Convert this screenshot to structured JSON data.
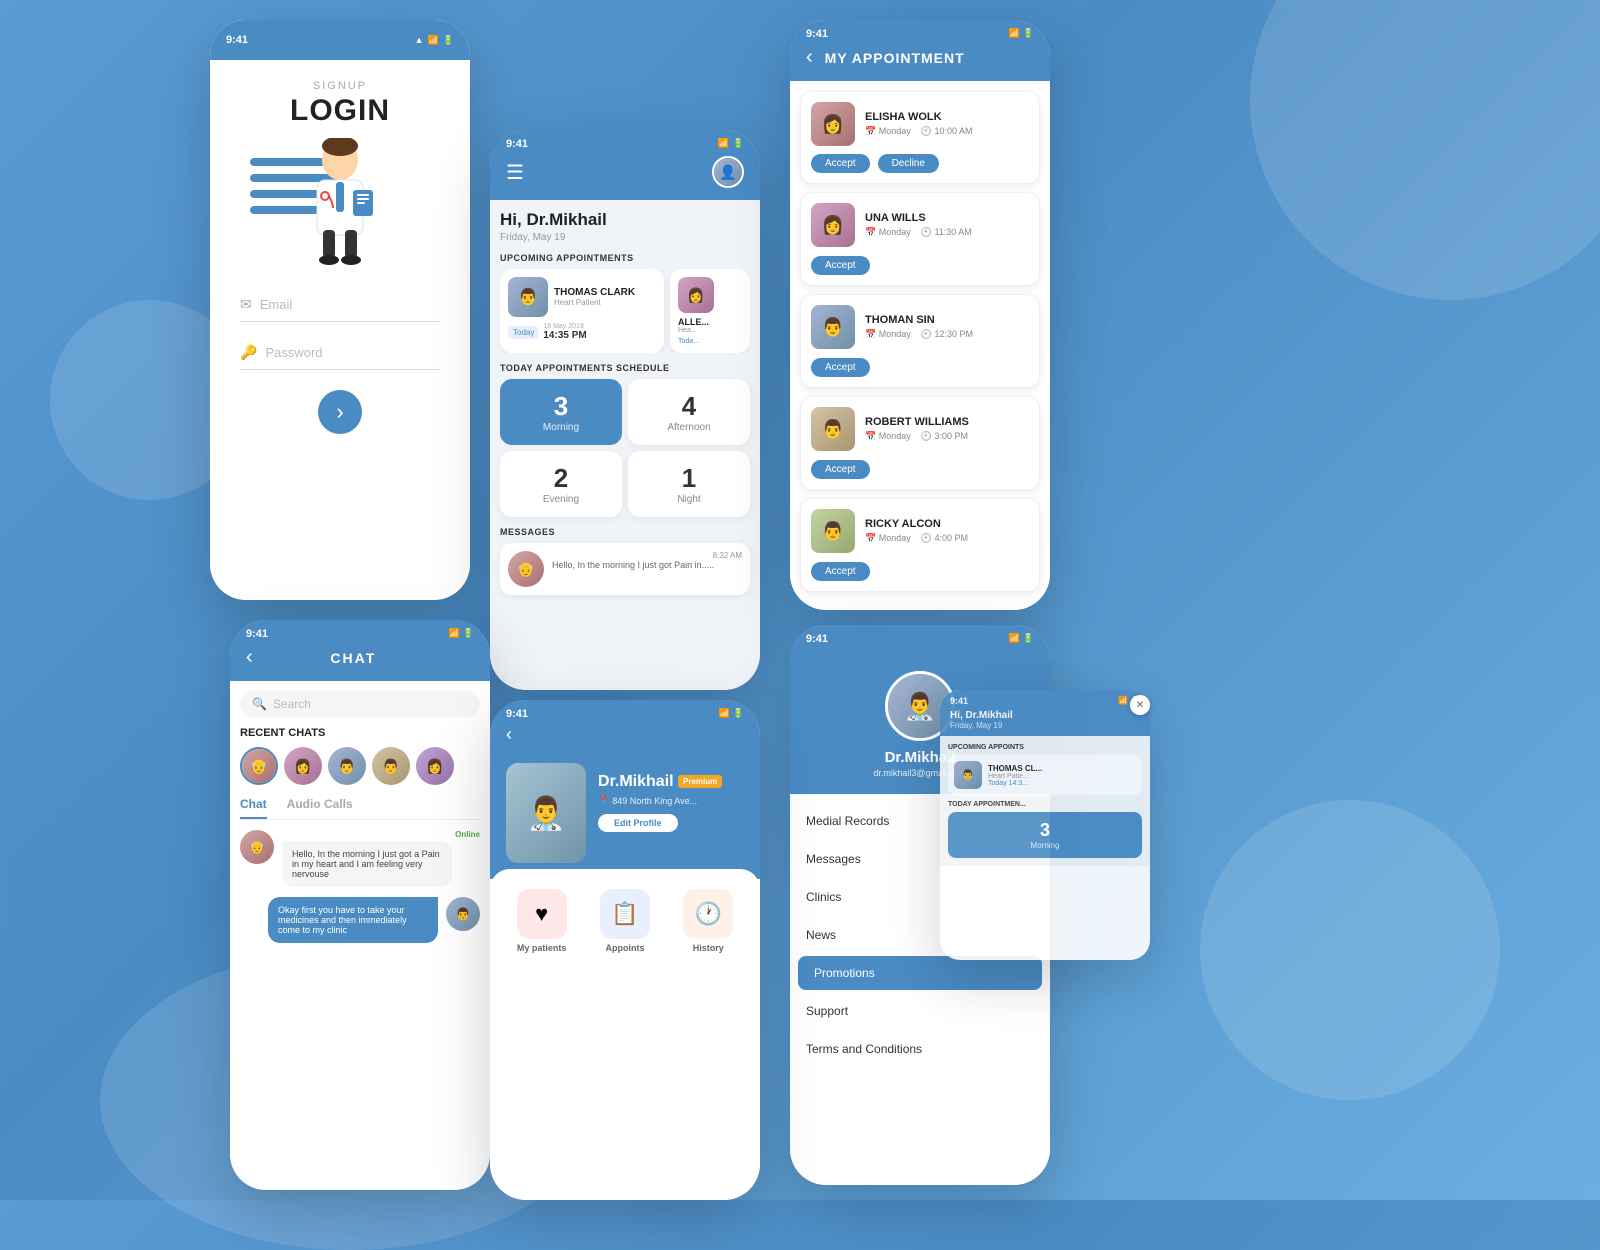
{
  "app": {
    "status_time": "9:41"
  },
  "login_screen": {
    "signup_label": "SIGNUP",
    "login_label": "LOGIN",
    "email_placeholder": "Email",
    "password_placeholder": "Password",
    "next_button": "›"
  },
  "dashboard": {
    "greeting": "Hi, Dr.Mikhail",
    "date": "Friday, May 19",
    "upcoming_title": "UPCOMING APPOINTMENTS",
    "appointments": [
      {
        "name": "THOMAS CLARK",
        "type": "Heart Patient",
        "day": "Today",
        "date": "18 May 2019",
        "time": "14:35 PM",
        "avatar_class": "fp2"
      },
      {
        "name": "ALLE...",
        "type": "Hea...",
        "day": "Toda...",
        "date": "",
        "time": "",
        "avatar_class": "fp7"
      }
    ],
    "schedule_title": "TODAY APPOINTMENTS SCHEDULE",
    "schedule": [
      {
        "count": "3",
        "label": "Morning",
        "highlighted": true
      },
      {
        "count": "4",
        "label": "Afternoon",
        "highlighted": false
      },
      {
        "count": "2",
        "label": "Evening",
        "highlighted": false
      },
      {
        "count": "1",
        "label": "Night",
        "highlighted": false
      }
    ],
    "messages_title": "MESSAGES",
    "message": {
      "text": "Hello, In the morning I just got Pain in.....",
      "time": "8:32 AM",
      "avatar_class": "fp1"
    }
  },
  "appointment_screen": {
    "title": "MY APPOINTMENT",
    "back_label": "‹",
    "patients": [
      {
        "name": "ELISHA WOLK",
        "day": "Monday",
        "time": "10:00 AM",
        "actions": [
          "Accept",
          "Decline"
        ],
        "avatar_class": "fp1"
      },
      {
        "name": "UNA WILLS",
        "day": "Monday",
        "time": "11:30 AM",
        "actions": [
          "Accept"
        ],
        "avatar_class": "fp7"
      },
      {
        "name": "THOMAN SIN",
        "day": "Monday",
        "time": "12:30 PM",
        "actions": [
          "Accept"
        ],
        "avatar_class": "fp2"
      },
      {
        "name": "ROBERT WILLIAMS",
        "day": "Monday",
        "time": "3:00 PM",
        "actions": [
          "Accept"
        ],
        "avatar_class": "fp4"
      },
      {
        "name": "RICKY ALCON",
        "day": "Monday",
        "time": "4:00 PM",
        "actions": [
          "Accept"
        ],
        "avatar_class": "fp8"
      }
    ]
  },
  "chat_screen": {
    "title": "CHAT",
    "back_label": "‹",
    "search_placeholder": "Search",
    "recent_chats_label": "RECENT CHATS",
    "tabs": [
      "Chat",
      "Audio Calls"
    ],
    "active_tab": "Chat",
    "avatars": [
      "fp1",
      "fp7",
      "fp2",
      "fp4",
      "fp5"
    ],
    "messages": [
      {
        "sender": "Patient",
        "text": "Hello, In the morning I just got a Pain in my heart and I am feeling very nervouse",
        "online": true,
        "avatar_class": "fp1"
      },
      {
        "sender": "Doctor",
        "text": "Okay first you have to take your medicines and then immediately come to my clinic",
        "avatar_class": "fp2"
      }
    ]
  },
  "profile_screen": {
    "name": "Dr.Mikhail",
    "email": "dr.mikhail3@gmail.com",
    "menu_items": [
      "Medial Records",
      "Messages",
      "Clinics",
      "News",
      "Promotions",
      "Support",
      "Terms and Conditions"
    ],
    "active_menu": "Promotions"
  },
  "patient_profile": {
    "back_label": "‹",
    "name": "Dr.Mikhail",
    "premium_label": "Premium",
    "location": "849 North King Ave...",
    "edit_button": "Edit Profile",
    "icons": [
      {
        "label": "My patients",
        "icon": "♥",
        "class": "icon-heart"
      },
      {
        "label": "Appoints",
        "icon": "📋",
        "class": "icon-appt"
      },
      {
        "label": "History",
        "icon": "🕐",
        "class": "icon-hist"
      }
    ]
  }
}
